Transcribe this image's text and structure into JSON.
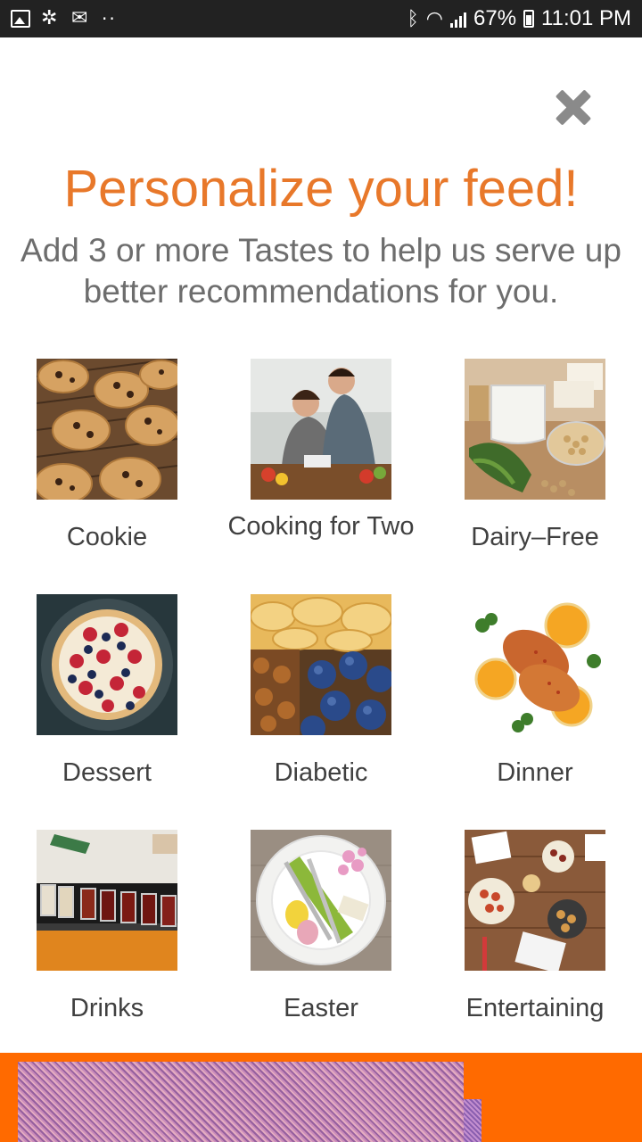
{
  "status_bar": {
    "percent": "67%",
    "time": "11:01 PM",
    "left_icons": [
      "image-icon",
      "fan-icon",
      "mail-icon",
      "more-dots-icon"
    ],
    "right_icons": [
      "bluetooth-icon",
      "wifi-icon",
      "signal-icon",
      "battery-icon"
    ]
  },
  "dialog": {
    "close_icon": "close-icon",
    "title": "Personalize your feed!",
    "subtitle": "Add 3 or more Tastes to help us serve up better recommendations for you.",
    "colors": {
      "title": "#e8782a",
      "subtitle": "#6d6d6d",
      "bottom_bar": "#ff6a00"
    }
  },
  "tastes": [
    {
      "label": "Cookie"
    },
    {
      "label": "Cooking for Two"
    },
    {
      "label": "Dairy–Free"
    },
    {
      "label": "Dessert"
    },
    {
      "label": "Diabetic"
    },
    {
      "label": "Dinner"
    },
    {
      "label": "Drinks"
    },
    {
      "label": "Easter"
    },
    {
      "label": "Entertaining"
    }
  ]
}
